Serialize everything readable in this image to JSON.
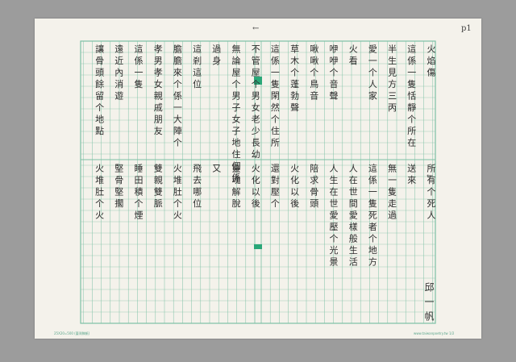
{
  "page": {
    "page_number": "p1",
    "margin_mark_top": "←",
    "margin_mark_right": "←",
    "signature": "邱一帆",
    "footer_left": "25X20=500  (臺灣稿紙)",
    "footer_right": "www.taiwanpoetry.tw  1/2"
  },
  "poem": {
    "top_columns": [
      "火焰傷",
      "這係一隻恬靜个所在",
      "半生見方三丙",
      "愛一个人家",
      "火看",
      "咿咿个音聲",
      "啾啾个鳥音",
      "草木个蓬勃聲",
      "這係一隻閑然个住所",
      "不管屋个男女老少長幼",
      "無論屋个男子女子地住個係",
      "過身",
      "這剎這位",
      "膽膽來个係一大陣个",
      "孝男孝女親戚朋友",
      "這係一隻",
      "遠近內消遊",
      "讓骨頭餘留个地點"
    ],
    "bottom_columns": [
      "所有个死人",
      "送來",
      "無一隻走過",
      "這係一隻死者个地方",
      "人在世間愛樣般生活",
      "人生在世愛壓个光景",
      "陪求骨頭",
      "火化以後",
      "還對壓个",
      "火化以後",
      "靈魂解脫",
      "又",
      "飛去哪位",
      "火堆肚个火",
      "雙親雙脈",
      "睡田積个煙",
      "堅骨堅擱",
      "火堆肚个火"
    ]
  }
}
